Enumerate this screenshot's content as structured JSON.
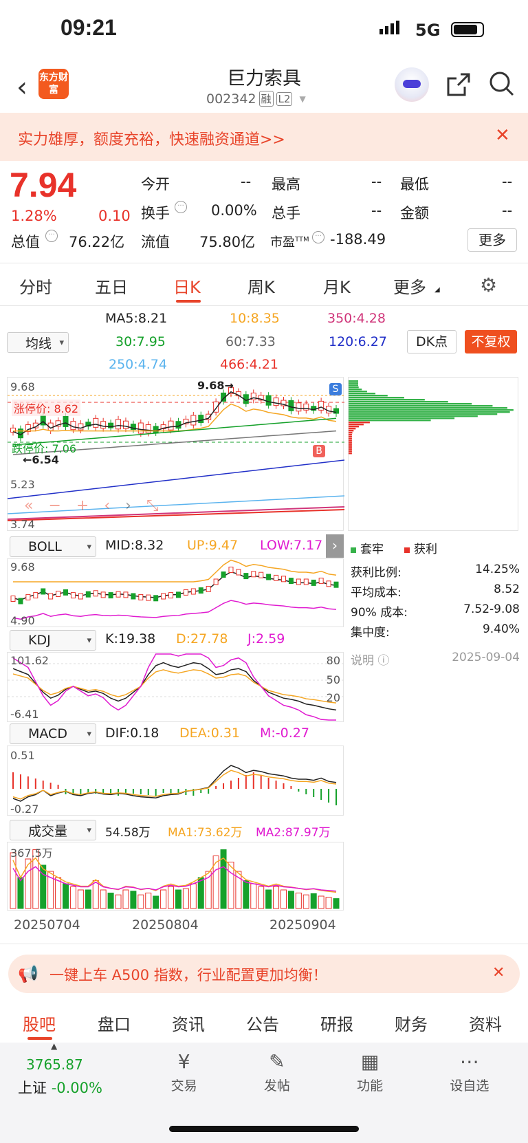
{
  "status": {
    "time": "09:21",
    "network": "5G"
  },
  "header": {
    "title": "巨力索具",
    "code": "002342",
    "badge1": "融",
    "badge2": "L2",
    "logo": "东方财富"
  },
  "banner": {
    "text": "实力雄厚，额度充裕，快速融资通道>>"
  },
  "quote": {
    "price": "7.94",
    "pct": "1.28%",
    "chg": "0.10",
    "open_label": "今开",
    "open": "--",
    "high_label": "最高",
    "high": "--",
    "low_label": "最低",
    "low": "--",
    "turnover_label": "换手",
    "turnover": "0.00%",
    "vol_label": "总手",
    "vol": "--",
    "amount_label": "金额",
    "amount": "--",
    "mcap_label": "总值",
    "mcap": "76.22亿",
    "float_label": "流值",
    "float": "75.80亿",
    "pe_label": "市盈",
    "pe_sup": "TTM",
    "pe": "-188.49",
    "more": "更多"
  },
  "tabs": [
    "分时",
    "五日",
    "日K",
    "周K",
    "月K",
    "更多"
  ],
  "active_tab": "日K",
  "ma": {
    "select": "均线",
    "ma5": "MA5:8.21",
    "ma10": "10:8.35",
    "ma350": "350:4.28",
    "ma30": "30:7.95",
    "ma60": "60:7.33",
    "ma120": "120:6.27",
    "ma250": "250:4.74",
    "ma466": "466:4.21",
    "dk": "DK点",
    "fuquan": "不复权"
  },
  "kchart": {
    "y_top": "9.68",
    "y_3": "5.23",
    "y_bottom": "3.74",
    "peak_label": "9.68→",
    "low_label": "←6.54",
    "limit_up": "涨停价: 8.62",
    "limit_down": "跌停价: 7.06",
    "s": "S",
    "b": "B",
    "peak_value": 9.68,
    "low_value": 6.54
  },
  "chip": {
    "legend_trap": "套牢",
    "legend_profit": "获利",
    "rows": [
      {
        "k": "获利比例:",
        "v": "14.25%"
      },
      {
        "k": "平均成本:",
        "v": "8.52"
      },
      {
        "k": "90% 成本:",
        "v": "7.52-9.08"
      },
      {
        "k": "集中度:",
        "v": "9.40%"
      }
    ],
    "note": "说明",
    "date": "2025-09-04"
  },
  "boll": {
    "select": "BOLL",
    "mid": "MID:8.32",
    "up": "UP:9.47",
    "low": "LOW:7.17",
    "y_top": "9.68",
    "y_bottom": "4.90"
  },
  "kdj": {
    "select": "KDJ",
    "k": "K:19.38",
    "d": "D:27.78",
    "j": "J:2.59",
    "y_top": "101.62",
    "y_bottom": "-6.41",
    "l80": "80",
    "l50": "50",
    "l20": "20"
  },
  "macd": {
    "select": "MACD",
    "dif": "DIF:0.18",
    "dea": "DEA:0.31",
    "m": "M:-0.27",
    "y_top": "0.51",
    "y_bottom": "-0.27"
  },
  "volume": {
    "select": "成交量",
    "vol": "54.58万",
    "ma1": "MA1:73.62万",
    "ma2": "MA2:87.97万",
    "y_top": "367.5万"
  },
  "dates": [
    "20250704",
    "20250804",
    "20250904"
  ],
  "promo": {
    "text": "一键上车 A500 指数，行业配置更加均衡！"
  },
  "subtabs": [
    "股吧",
    "盘口",
    "资讯",
    "公告",
    "研报",
    "财务",
    "资料"
  ],
  "active_subtab": "股吧",
  "bottom": {
    "index_value": "3765.87",
    "index_name": "上证",
    "index_chg": "-0.00%",
    "items": [
      "交易",
      "发帖",
      "功能",
      "设自选"
    ]
  }
}
